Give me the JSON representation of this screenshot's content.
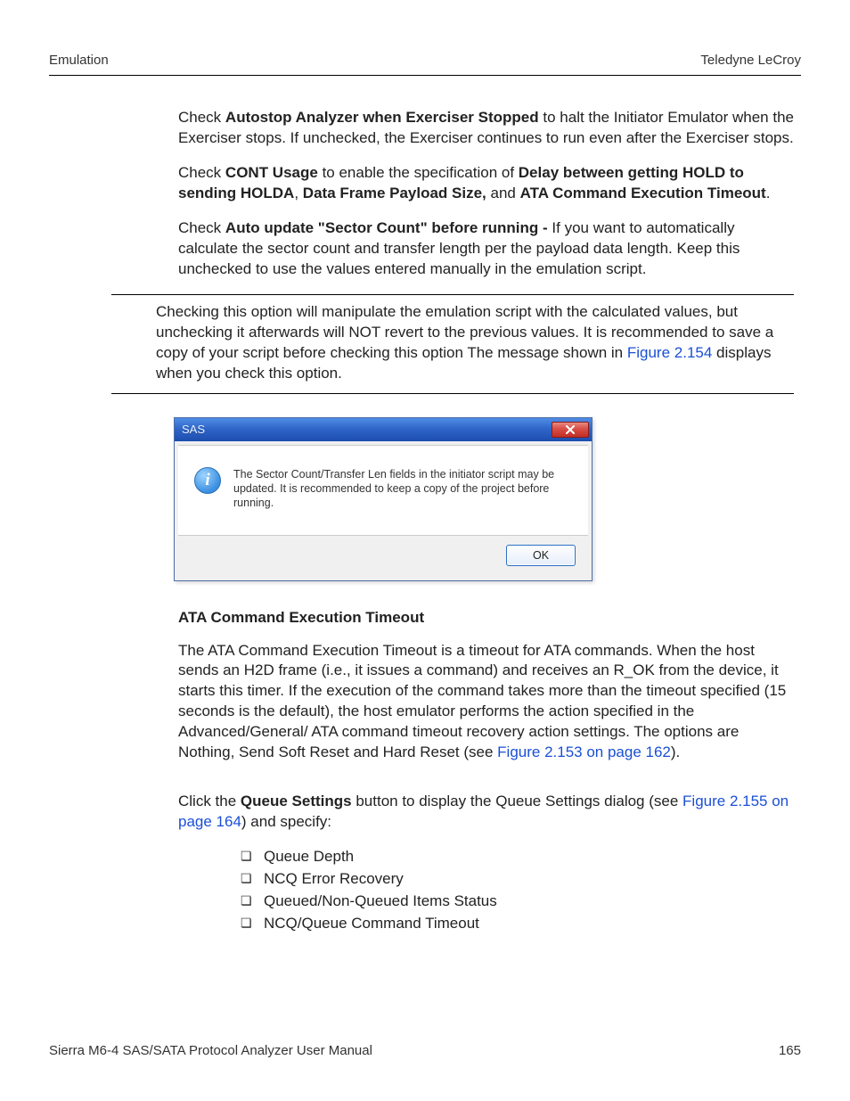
{
  "header": {
    "left": "Emulation",
    "right": "Teledyne LeCroy"
  },
  "p1": {
    "pre": "Check ",
    "b1": "Autostop Analyzer when Exerciser Stopped",
    "post": " to halt the Initiator Emulator when the Exerciser stops. If unchecked, the Exerciser continues to run even after the Exerciser stops."
  },
  "p2": {
    "s1": "Check ",
    "b1": "CONT Usage",
    "s2": " to enable the specification of ",
    "b2": "Delay between getting HOLD to sending HOLDA",
    "s3": ", ",
    "b3": "Data Frame Payload Size,",
    "s4": " and ",
    "b4": "ATA Command Execution Timeout",
    "s5": "."
  },
  "p3": {
    "s1": "Check ",
    "b1": "Auto update \"Sector Count\" before running - ",
    "s2": "If you want to automatically calculate the sector count and transfer length per the payload data length. Keep this unchecked to use the values entered manually in the emulation script."
  },
  "note": {
    "s1": "Checking this option will manipulate the emulation script with the calculated values, but unchecking it afterwards will NOT revert to the previous values. It is recommended to save a copy of your script before checking this option The message shown in ",
    "link": "Figure 2.154",
    "s2": " displays when you check this option."
  },
  "dialog": {
    "title": "SAS",
    "message": "The Sector Count/Transfer Len fields in the initiator script may be updated. It is recommended to keep a copy of the project before running.",
    "ok": "OK"
  },
  "sec_title": "ATA Command Execution Timeout",
  "p4": {
    "s1": "The ATA Command Execution Timeout is a timeout for ATA commands. When the host sends an H2D frame (i.e., it issues a command) and receives an R_OK from the device, it starts this timer. If the execution of the command takes more than the timeout specified (15 seconds is the default), the host emulator performs the action specified in the Advanced/General/ ATA command timeout recovery action settings. The options are Nothing, Send Soft Reset and Hard Reset (see ",
    "link": "Figure 2.153 on page 162",
    "s2": ")."
  },
  "p5": {
    "s1": "Click the ",
    "b1": "Queue Settings",
    "s2": " button to display the Queue Settings dialog (see ",
    "link": "Figure 2.155 on page 164",
    "s3": ") and specify:"
  },
  "bullets": [
    "Queue Depth",
    "NCQ Error Recovery",
    "Queued/Non-Queued Items Status",
    "NCQ/Queue Command Timeout"
  ],
  "footer": {
    "left": "Sierra M6-4 SAS/SATA Protocol Analyzer User Manual",
    "page": "165"
  }
}
